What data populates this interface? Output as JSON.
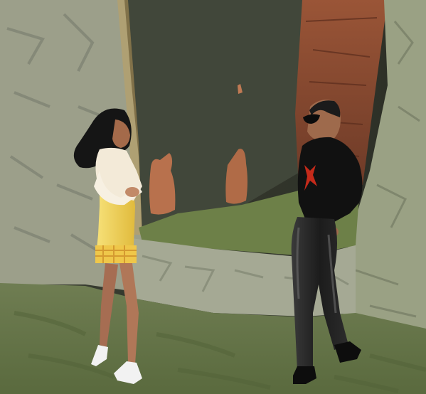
{
  "scene": {
    "palette": {
      "sky_gap": "#3a3c30",
      "stone_light": "#a9ab95",
      "stone_mid": "#8e937a",
      "stone_dark": "#5d6350",
      "clay": "#8e4a30",
      "clay_dark": "#6a3422",
      "ground": "#66784a",
      "ground_dark": "#4a5a34",
      "dress_yellow": "#f2d24a",
      "shirt_black": "#111111",
      "pants_black": "#1d1d1d",
      "mark_red": "#c52a1a",
      "skin": "#b77d5c",
      "hair": "#141414"
    }
  }
}
